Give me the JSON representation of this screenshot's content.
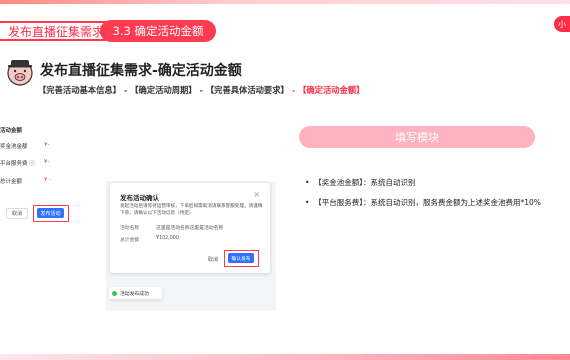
{
  "header": {
    "title": "发布直播征集需求",
    "tag": "3.3 确定活动金额",
    "logo_text": "小"
  },
  "main_heading": "发布直播征集需求-确定活动金额",
  "breadcrumb": {
    "steps": [
      "【完善活动基本信息】",
      "【确定活动周期】",
      "【完善具体活动要求】",
      "【确定活动金额】"
    ],
    "separator": "-"
  },
  "form": {
    "section_title": "活动金额",
    "rows": [
      {
        "label": "奖金池金额",
        "value": "¥-"
      },
      {
        "label": "平台服务费 ⓘ",
        "value": "¥-"
      },
      {
        "label": "总计金额",
        "value": "¥ -"
      }
    ],
    "cancel_label": "取消",
    "publish_label": "发布活动"
  },
  "dialog": {
    "title": "发布活动确认",
    "close_symbol": "×",
    "description": "发起活动后请等待运营审核，下单后如需取消请联系客服处理，请谨慎下单，请确认以下活动信息（待定）",
    "fields": [
      {
        "label": "活动名称",
        "value": "这里是活动名称这里是活动名称"
      },
      {
        "label": "总计金额",
        "value": "¥102,000"
      }
    ],
    "cancel_label": "取消",
    "confirm_label": "确认发布"
  },
  "toast": {
    "text": "活动发布成功"
  },
  "right_panel": {
    "title": "填写模块",
    "bullets": [
      "【奖金池金额】：系统自动识别",
      "【平台服务费】：系统自动识别，服务费金额为上述奖金池费用*10%"
    ]
  },
  "colors": {
    "accent": "#ff3b52",
    "primary_button": "#3370ff",
    "panel": "#ffb3c1"
  }
}
